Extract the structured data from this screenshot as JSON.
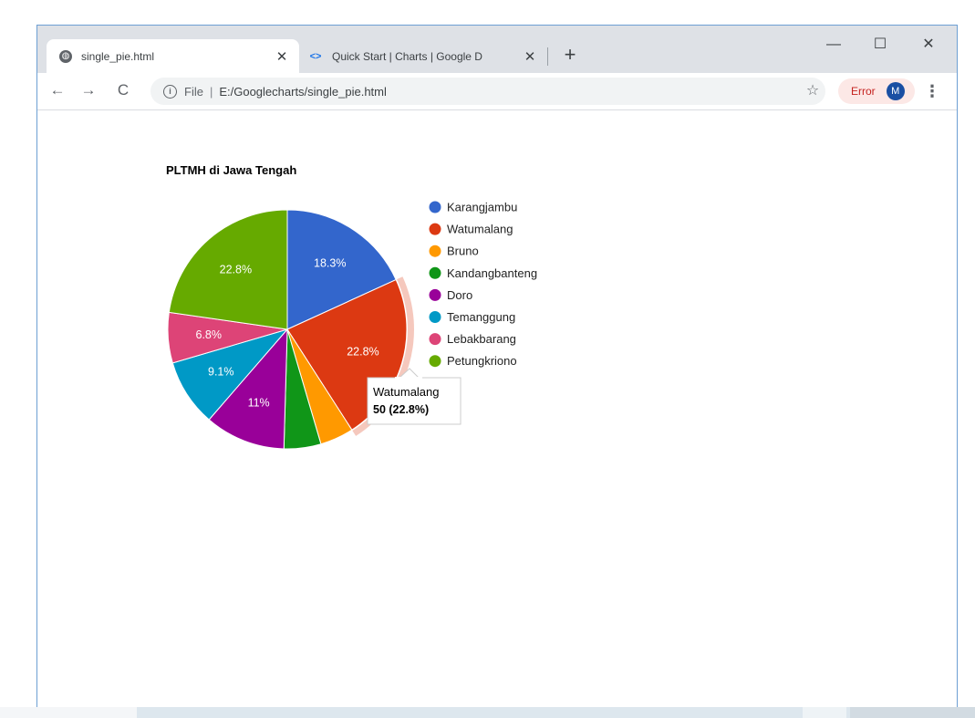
{
  "browser": {
    "tabs": [
      {
        "title": "single_pie.html",
        "active": true,
        "icon": "globe-icon"
      },
      {
        "title": "Quick Start  |  Charts  |  Google D",
        "active": false,
        "icon": "google-dev-icon"
      }
    ],
    "close_glyph": "✕",
    "new_tab_glyph": "+",
    "window_controls": {
      "minimize": "—",
      "maximize": "☐",
      "close": "✕"
    },
    "nav": {
      "back": "←",
      "forward": "→",
      "reload": "C"
    },
    "address": {
      "scheme_label": "File",
      "separator": "|",
      "url": "E:/Googlecharts/single_pie.html"
    },
    "star_glyph": "☆",
    "error_label": "Error",
    "avatar_letter": "M",
    "menu_glyph": "⋮"
  },
  "chart_data": {
    "type": "pie",
    "title": "PLTMH di Jawa Tengah",
    "legend_position": "right",
    "slices": [
      {
        "label": "Karangjambu",
        "value": 40,
        "percent_label": "18.3%",
        "color": "#3366cc"
      },
      {
        "label": "Watumalang",
        "value": 50,
        "percent_label": "22.8%",
        "color": "#dc3912"
      },
      {
        "label": "Bruno",
        "value": 10,
        "percent_label": "",
        "color": "#ff9900"
      },
      {
        "label": "Kandangbanteng",
        "value": 11,
        "percent_label": "",
        "color": "#109618"
      },
      {
        "label": "Doro",
        "value": 24,
        "percent_label": "11%",
        "color": "#990099"
      },
      {
        "label": "Temanggung",
        "value": 20,
        "percent_label": "9.1%",
        "color": "#0099c6"
      },
      {
        "label": "Lebakbarang",
        "value": 15,
        "percent_label": "6.8%",
        "color": "#dd4477"
      },
      {
        "label": "Petungkriono",
        "value": 50,
        "percent_label": "22.8%",
        "color": "#66aa00"
      }
    ],
    "highlighted_slice": 1,
    "tooltip": {
      "name": "Watumalang",
      "value_text": "50 (22.8%)"
    }
  }
}
